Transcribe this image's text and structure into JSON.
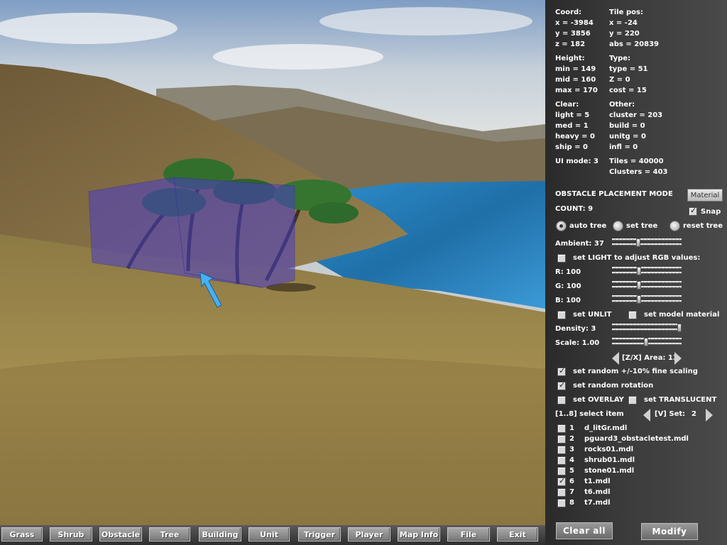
{
  "info": {
    "coord_header": "Coord:",
    "coord_x": "x = -3984",
    "coord_y": "y = 3856",
    "coord_z": "z = 182",
    "tile_header": "Tile pos:",
    "tile_x": "x = -24",
    "tile_y": "y = 220",
    "tile_abs": "abs = 20839",
    "height_header": "Height:",
    "height_min": "min = 149",
    "height_mid": "mid = 160",
    "height_max": "max = 170",
    "type_header": "Type:",
    "type_type": "type = 51",
    "type_z": "Z = 0",
    "type_cost": "cost = 15",
    "clear_header": "Clear:",
    "clear_light": "light = 5",
    "clear_med": "med = 1",
    "clear_heavy": "heavy = 0",
    "clear_ship": "ship = 0",
    "other_header": "Other:",
    "other_cluster": "cluster = 203",
    "other_build": "build = 0",
    "other_unitg": "unitg = 0",
    "other_infl": "infl = 0",
    "ui_mode": "UI mode: 3",
    "tiles": "Tiles = 40000",
    "clusters": "Clusters = 403"
  },
  "obstacle": {
    "mode_title": "OBSTACLE PLACEMENT MODE",
    "material_button": "Material",
    "count": "COUNT: 9",
    "snap_label": "Snap",
    "snap_checked": true,
    "radio_auto": "auto tree",
    "radio_set": "set tree",
    "radio_reset": "reset tree",
    "radio_selected": "auto tree",
    "ambient_label": "Ambient: 37",
    "ambient_value": 37,
    "set_light_label": "set LIGHT to adjust RGB values:",
    "set_light_checked": false,
    "r_label": "R: 100",
    "g_label": "G: 100",
    "b_label": "B: 100",
    "r_value": 100,
    "g_value": 100,
    "b_value": 100,
    "unlit_label": "set UNLIT",
    "unlit_checked": false,
    "model_material_label": "set model material",
    "model_material_checked": false,
    "density_label": "Density: 3",
    "density_value": 3,
    "scale_label": "Scale: 1.00",
    "scale_value": 1.0,
    "area_label": "[Z/X] Area: 13",
    "random_scaling_label": "set random +/-10% fine scaling",
    "random_scaling_checked": true,
    "random_rotation_label": "set random rotation",
    "random_rotation_checked": true,
    "overlay_label": "set OVERLAY",
    "overlay_checked": false,
    "translucent_label": "set TRANSLUCENT",
    "translucent_checked": false,
    "select_item_label": "[1..8] select item",
    "set_label": "[V] Set:",
    "set_value": "2",
    "items": [
      {
        "num": "1",
        "name": "d_litGr.mdl",
        "checked": false
      },
      {
        "num": "2",
        "name": "pguard3_obstacletest.mdl",
        "checked": false
      },
      {
        "num": "3",
        "name": "rocks01.mdl",
        "checked": false
      },
      {
        "num": "4",
        "name": "shrub01.mdl",
        "checked": false
      },
      {
        "num": "5",
        "name": "stone01.mdl",
        "checked": false
      },
      {
        "num": "6",
        "name": "t1.mdl",
        "checked": true
      },
      {
        "num": "7",
        "name": "t6.mdl",
        "checked": false
      },
      {
        "num": "8",
        "name": "t7.mdl",
        "checked": false
      }
    ],
    "clear_all": "Clear all",
    "modify": "Modify"
  },
  "toolbar": {
    "grass": "Grass",
    "shrub": "Shrub",
    "obstacle": "Obstacle",
    "tree": "Tree",
    "building": "Building",
    "unit": "Unit",
    "trigger": "Trigger",
    "player": "Player",
    "map_info": "Map Info",
    "file": "File",
    "exit": "Exit"
  },
  "colors": {
    "selection_box": "#4a3cc8",
    "water": "#2c7fb8",
    "grass": "#a08a4a"
  },
  "icons": {
    "cursor": "pointer-arrow-icon",
    "prev": "triangle-left-icon",
    "next": "triangle-right-icon"
  }
}
